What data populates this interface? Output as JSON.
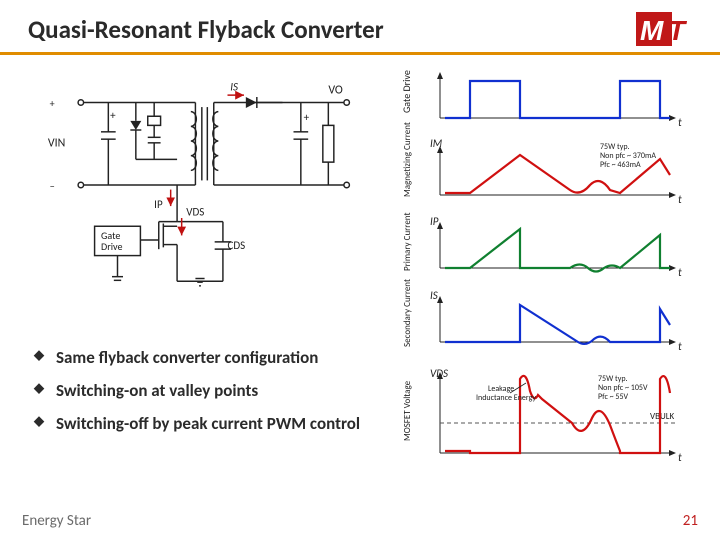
{
  "title": "Quasi-Resonant Flyback Converter",
  "logo": {
    "text1": "M",
    "text2": "T"
  },
  "circuit": {
    "labels": {
      "vin": "VIN",
      "ip": "IP",
      "is": "IS",
      "vo": "VO",
      "vds": "VDS",
      "cds": "CDS",
      "gate_drive": "Gate\nDrive"
    }
  },
  "waveforms": [
    {
      "ylabel": "Gate Drive",
      "annotation": "",
      "color": "#1030d0",
      "xaxis": "t"
    },
    {
      "ylabel": "Magnetizing Current",
      "annotation": "75W typ.\nNon pfc ~ 370mA\nPfc ~ 463mA",
      "color": "#d01010",
      "xaxis": "t",
      "leader": "IM"
    },
    {
      "ylabel": "Primary Current",
      "annotation": "",
      "color": "#108030",
      "xaxis": "t",
      "leader": "IP"
    },
    {
      "ylabel": "Secondary Current",
      "annotation": "",
      "color": "#1030d0",
      "xaxis": "t",
      "leader": "IS"
    },
    {
      "ylabel": "MOSFET Voltage",
      "annotation": "75W typ.\nNon pfc ~ 105V\nPfc ~ 55V",
      "annotation2": "Leakage Inductance Energy",
      "vbulk": "VBULK",
      "color": "#d01010",
      "xaxis": "t",
      "leader": "VDS"
    }
  ],
  "bullets": [
    "Same flyback converter configuration",
    "Switching-on at valley points",
    "Switching-off by peak current PWM control"
  ],
  "footer": "Energy Star",
  "pagenum": "21"
}
